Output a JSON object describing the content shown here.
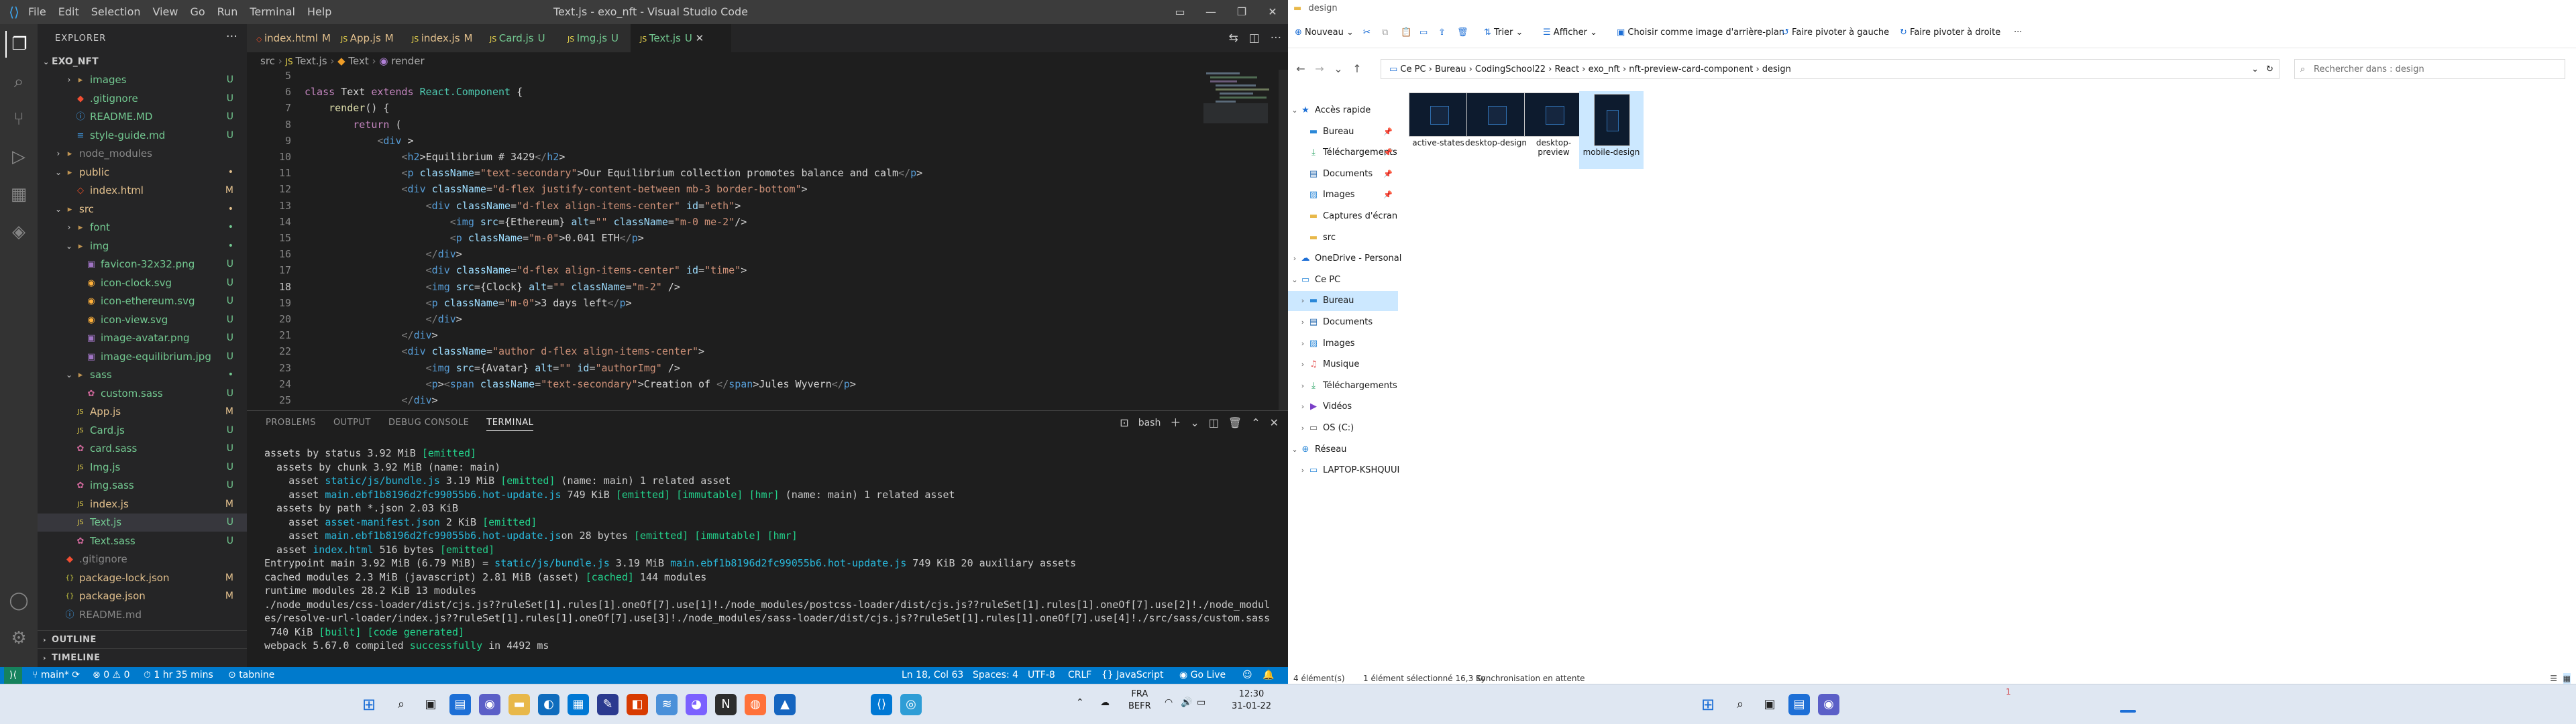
{
  "vscode": {
    "window_title": "Text.js - exo_nft - Visual Studio Code",
    "menu": [
      "File",
      "Edit",
      "Selection",
      "View",
      "Go",
      "Run",
      "Terminal",
      "Help"
    ],
    "explorer_header": "EXPLORER",
    "project": "EXO_NFT",
    "tree": [
      {
        "name": "images",
        "type": "folder",
        "open": false,
        "status": "U",
        "status_color": "#73c991"
      },
      {
        "name": ".gitignore",
        "type": "git",
        "status": "U",
        "status_color": "#73c991"
      },
      {
        "name": "README.MD",
        "type": "info",
        "status": "U",
        "status_color": "#73c991"
      },
      {
        "name": "style-guide.md",
        "type": "md",
        "status": "U",
        "status_color": "#73c991"
      },
      {
        "name": "node_modules",
        "type": "folder",
        "open": false,
        "status": "",
        "status_color": "#888888"
      },
      {
        "name": "public",
        "type": "folder",
        "open": true,
        "status": "•",
        "status_color": "#e2c08d"
      },
      {
        "name": "index.html",
        "type": "html",
        "status": "M",
        "status_color": "#e2c08d"
      },
      {
        "name": "src",
        "type": "folder",
        "open": true,
        "status": "•",
        "status_color": "#e2c08d"
      },
      {
        "name": "font",
        "type": "folder",
        "open": false,
        "status": "•",
        "status_color": "#73c991"
      },
      {
        "name": "img",
        "type": "folder",
        "open": true,
        "status": "•",
        "status_color": "#73c991"
      },
      {
        "name": "favicon-32x32.png",
        "type": "img",
        "status": "U",
        "status_color": "#73c991"
      },
      {
        "name": "icon-clock.svg",
        "type": "svg",
        "status": "U",
        "status_color": "#73c991"
      },
      {
        "name": "icon-ethereum.svg",
        "type": "svg",
        "status": "U",
        "status_color": "#73c991"
      },
      {
        "name": "icon-view.svg",
        "type": "svg",
        "status": "U",
        "status_color": "#73c991"
      },
      {
        "name": "image-avatar.png",
        "type": "img",
        "status": "U",
        "status_color": "#73c991"
      },
      {
        "name": "image-equilibrium.jpg",
        "type": "img",
        "status": "U",
        "status_color": "#73c991"
      },
      {
        "name": "sass",
        "type": "folder",
        "open": true,
        "status": "•",
        "status_color": "#73c991"
      },
      {
        "name": "custom.sass",
        "type": "sass",
        "status": "U",
        "status_color": "#73c991"
      },
      {
        "name": "App.js",
        "type": "js",
        "status": "M",
        "status_color": "#e2c08d"
      },
      {
        "name": "Card.js",
        "type": "js",
        "status": "U",
        "status_color": "#73c991"
      },
      {
        "name": "card.sass",
        "type": "sass",
        "status": "U",
        "status_color": "#73c991"
      },
      {
        "name": "Img.js",
        "type": "js",
        "status": "U",
        "status_color": "#73c991"
      },
      {
        "name": "img.sass",
        "type": "sass",
        "status": "U",
        "status_color": "#73c991"
      },
      {
        "name": "index.js",
        "type": "js",
        "status": "M",
        "status_color": "#e2c08d"
      },
      {
        "name": "Text.js",
        "type": "js",
        "status": "U",
        "status_color": "#73c991",
        "selected": true
      },
      {
        "name": "Text.sass",
        "type": "sass",
        "status": "U",
        "status_color": "#73c991"
      },
      {
        "name": ".gitignore",
        "type": "git",
        "status": "",
        "status_color": "#888888"
      },
      {
        "name": "package-lock.json",
        "type": "json",
        "status": "M",
        "status_color": "#e2c08d"
      },
      {
        "name": "package.json",
        "type": "json",
        "status": "M",
        "status_color": "#e2c08d"
      },
      {
        "name": "README.md",
        "type": "info",
        "status": "",
        "status_color": "#888888"
      }
    ],
    "outline_label": "OUTLINE",
    "timeline_label": "TIMELINE",
    "tabs": [
      {
        "label": "index.html",
        "status": "M",
        "active": false
      },
      {
        "label": "App.js",
        "status": "M",
        "active": false
      },
      {
        "label": "index.js",
        "status": "M",
        "active": false
      },
      {
        "label": "Card.js",
        "status": "U",
        "active": false
      },
      {
        "label": "Img.js",
        "status": "U",
        "active": false
      },
      {
        "label": "Text.js",
        "status": "U",
        "active": true
      }
    ],
    "breadcrumb": [
      "src",
      "Text.js",
      "Text",
      "render"
    ],
    "code_lines": [
      {
        "n": "5",
        "text": ""
      },
      {
        "n": "6",
        "text": "class Text extends React.Component {"
      },
      {
        "n": "7",
        "text": "    render() {"
      },
      {
        "n": "8",
        "text": "        return ("
      },
      {
        "n": "9",
        "text": "            <div >"
      },
      {
        "n": "10",
        "text": "                <h2>Equilibrium # 3429</h2>"
      },
      {
        "n": "11",
        "text": "                <p className=\"text-secondary\">Our Equilibrium collection promotes balance and calm</p>"
      },
      {
        "n": "12",
        "text": "                <div className=\"d-flex justify-content-between mb-3 border-bottom\">"
      },
      {
        "n": "13",
        "text": "                    <div className=\"d-flex align-items-center\" id=\"eth\">"
      },
      {
        "n": "14",
        "text": "                        <img src={Ethereum} alt=\"\" className=\"m-0 me-2\"/>"
      },
      {
        "n": "15",
        "text": "                        <p className=\"m-0\">0.041 ETH</p>"
      },
      {
        "n": "16",
        "text": "                    </div>"
      },
      {
        "n": "17",
        "text": "                    <div className=\"d-flex align-items-center\" id=\"time\">"
      },
      {
        "n": "18",
        "text": "                    <img src={Clock} alt=\"\" className=\"m-2\" />"
      },
      {
        "n": "19",
        "text": "                    <p className=\"m-0\">3 days left</p>"
      },
      {
        "n": "20",
        "text": "                    </div>"
      },
      {
        "n": "21",
        "text": "                </div>"
      },
      {
        "n": "22",
        "text": "                <div className=\"author d-flex align-items-center\">"
      },
      {
        "n": "23",
        "text": "                    <img src={Avatar} alt=\"\" id=\"authorImg\" />"
      },
      {
        "n": "24",
        "text": "                    <p><span className=\"text-secondary\">Creation of </span>Jules Wyvern</p>"
      },
      {
        "n": "25",
        "text": "                </div>"
      }
    ],
    "panel_tabs": [
      "PROBLEMS",
      "OUTPUT",
      "DEBUG CONSOLE",
      "TERMINAL"
    ],
    "terminal_shell": "bash",
    "terminal_lines": [
      {
        "text": "assets by status 3.92 MiB [emitted]",
        "color": "#cccccc"
      },
      {
        "text": "  assets by chunk 3.92 MiB (name: main)",
        "color": "#cccccc"
      },
      {
        "text": "    asset static/js/bundle.js 3.19 MiB [emitted] (name: main) 1 related asset",
        "color": "#cccccc"
      },
      {
        "text": "    asset main.ebf1b8196d2fc99055b6.hot-update.js 749 KiB [emitted] [immutable] [hmr] (name: main) 1 related asset",
        "color": "#cccccc"
      },
      {
        "text": "  assets by path *.json 2.03 KiB",
        "color": "#cccccc"
      },
      {
        "text": "    asset asset-manifest.json 2 KiB [emitted]",
        "color": "#cccccc"
      },
      {
        "text": "    asset main.ebf1b8196d2fc99055b6.hot-update.json 28 bytes [emitted] [immutable] [hmr]",
        "color": "#cccccc"
      },
      {
        "text": "  asset index.html 516 bytes [emitted]",
        "color": "#cccccc"
      },
      {
        "text": "Entrypoint main 3.92 MiB (6.79 MiB) = static/js/bundle.js 3.19 MiB main.ebf1b8196d2fc99055b6.hot-update.js 749 KiB 20 auxiliary assets",
        "color": "#cccccc"
      },
      {
        "text": "cached modules 2.3 MiB (javascript) 2.81 MiB (asset) [cached] 144 modules",
        "color": "#cccccc"
      },
      {
        "text": "runtime modules 28.2 KiB 13 modules",
        "color": "#cccccc"
      },
      {
        "text": "./node_modules/css-loader/dist/cjs.js??ruleSet[1].rules[1].oneOf[7].use[1]!./node_modules/postcss-loader/dist/cjs.js??ruleSet[1].rules[1].oneOf[7].use[2]!./node_modul",
        "color": "#cccccc"
      },
      {
        "text": "es/resolve-url-loader/index.js??ruleSet[1].rules[1].oneOf[7].use[3]!./node_modules/sass-loader/dist/cjs.js??ruleSet[1].rules[1].oneOf[7].use[4]!./src/sass/custom.sass",
        "color": "#cccccc"
      },
      {
        "text": " 740 KiB [built] [code generated]",
        "color": "#cccccc"
      },
      {
        "text": "webpack 5.67.0 compiled successfully in 4492 ms",
        "color": "#cccccc"
      }
    ],
    "status": {
      "branch": "main*",
      "errors": "0",
      "warnings": "0",
      "time": "1 hr 35 mins",
      "tabnine": "tabnine",
      "position": "Ln 18, Col 63",
      "spaces": "Spaces: 4",
      "encoding": "UTF-8",
      "eol": "CRLF",
      "language": "JavaScript",
      "golive": "Go Live"
    }
  },
  "explorer": {
    "title": "design",
    "ribbon": [
      "Nouveau",
      "Trier",
      "Afficher",
      "Choisir comme image d'arrière-plan",
      "Faire pivoter à gauche",
      "Faire pivoter à droite"
    ],
    "path": [
      "Ce PC",
      "Bureau",
      "CodingSchool22",
      "React",
      "exo_nft",
      "nft-preview-card-component",
      "design"
    ],
    "search_placeholder": "Rechercher dans : design",
    "nav": [
      {
        "label": "Accès rapide",
        "icon": "star",
        "level": 0,
        "chev": "v"
      },
      {
        "label": "Bureau",
        "icon": "folder-blue",
        "level": 1,
        "pin": true
      },
      {
        "label": "Téléchargements",
        "icon": "download",
        "level": 1,
        "pin": true
      },
      {
        "label": "Documents",
        "icon": "doc",
        "level": 1,
        "pin": true
      },
      {
        "label": "Images",
        "icon": "image",
        "level": 1,
        "pin": true
      },
      {
        "label": "Captures d'écran",
        "icon": "folder",
        "level": 1
      },
      {
        "label": "src",
        "icon": "folder",
        "level": 1
      },
      {
        "label": "OneDrive - Personal",
        "icon": "cloud",
        "level": 0,
        "chev": ">"
      },
      {
        "label": "Ce PC",
        "icon": "pc",
        "level": 0,
        "chev": "v"
      },
      {
        "label": "Bureau",
        "icon": "folder-blue",
        "level": 1,
        "chev": ">",
        "selected": true
      },
      {
        "label": "Documents",
        "icon": "doc",
        "level": 1,
        "chev": ">"
      },
      {
        "label": "Images",
        "icon": "image",
        "level": 1,
        "chev": ">"
      },
      {
        "label": "Musique",
        "icon": "music",
        "level": 1,
        "chev": ">"
      },
      {
        "label": "Téléchargements",
        "icon": "download",
        "level": 1,
        "chev": ">"
      },
      {
        "label": "Vidéos",
        "icon": "video",
        "level": 1,
        "chev": ">"
      },
      {
        "label": "OS (C:)",
        "icon": "drive",
        "level": 1,
        "chev": ">"
      },
      {
        "label": "Réseau",
        "icon": "network",
        "level": 0,
        "chev": "v"
      },
      {
        "label": "LAPTOP-KSHQUUI",
        "icon": "pc",
        "level": 1,
        "chev": ">"
      }
    ],
    "files": [
      {
        "name": "active-states",
        "selected": false
      },
      {
        "name": "desktop-design",
        "selected": false
      },
      {
        "name": "desktop-preview",
        "selected": false
      },
      {
        "name": "mobile-design",
        "selected": true
      }
    ],
    "status": {
      "count": "4 élément(s)",
      "selected": "1 élément sélectionné  16,3 Ko",
      "sync": "Synchronisation en attente"
    }
  },
  "taskbar": {
    "lang": "FRA",
    "layout": "BEFR",
    "time": "12:30",
    "date": "31-01-22",
    "badge": "1"
  }
}
